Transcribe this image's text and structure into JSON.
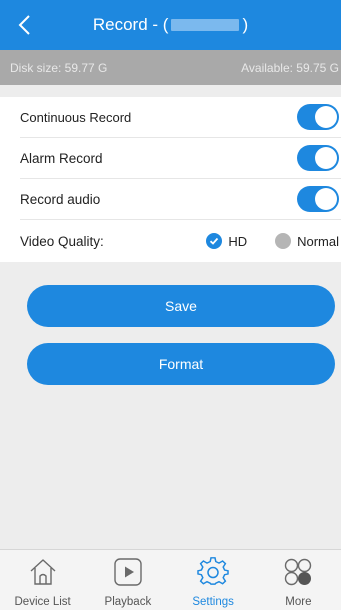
{
  "header": {
    "title_prefix": "Record  - (",
    "title_suffix": ")"
  },
  "disk": {
    "size": "Disk size: 59.77 G",
    "available": "Available: 59.75 G"
  },
  "settings": {
    "continuous_record": {
      "label": "Continuous Record",
      "on": true
    },
    "alarm_record": {
      "label": "Alarm Record",
      "on": true
    },
    "record_audio": {
      "label": "Record audio",
      "on": true
    },
    "video_quality": {
      "label": "Video Quality:",
      "options": [
        "HD",
        "Normal"
      ],
      "selected": "HD"
    }
  },
  "buttons": {
    "save": "Save",
    "format": "Format"
  },
  "tabs": [
    {
      "label": "Device List",
      "icon": "home-icon"
    },
    {
      "label": "Playback",
      "icon": "play-icon"
    },
    {
      "label": "Settings",
      "icon": "gear-icon",
      "active": true
    },
    {
      "label": "More",
      "icon": "more-circles-icon"
    }
  ],
  "colors": {
    "accent": "#1e88df",
    "disk_bar": "#a9a9a9",
    "background": "#ededed"
  }
}
